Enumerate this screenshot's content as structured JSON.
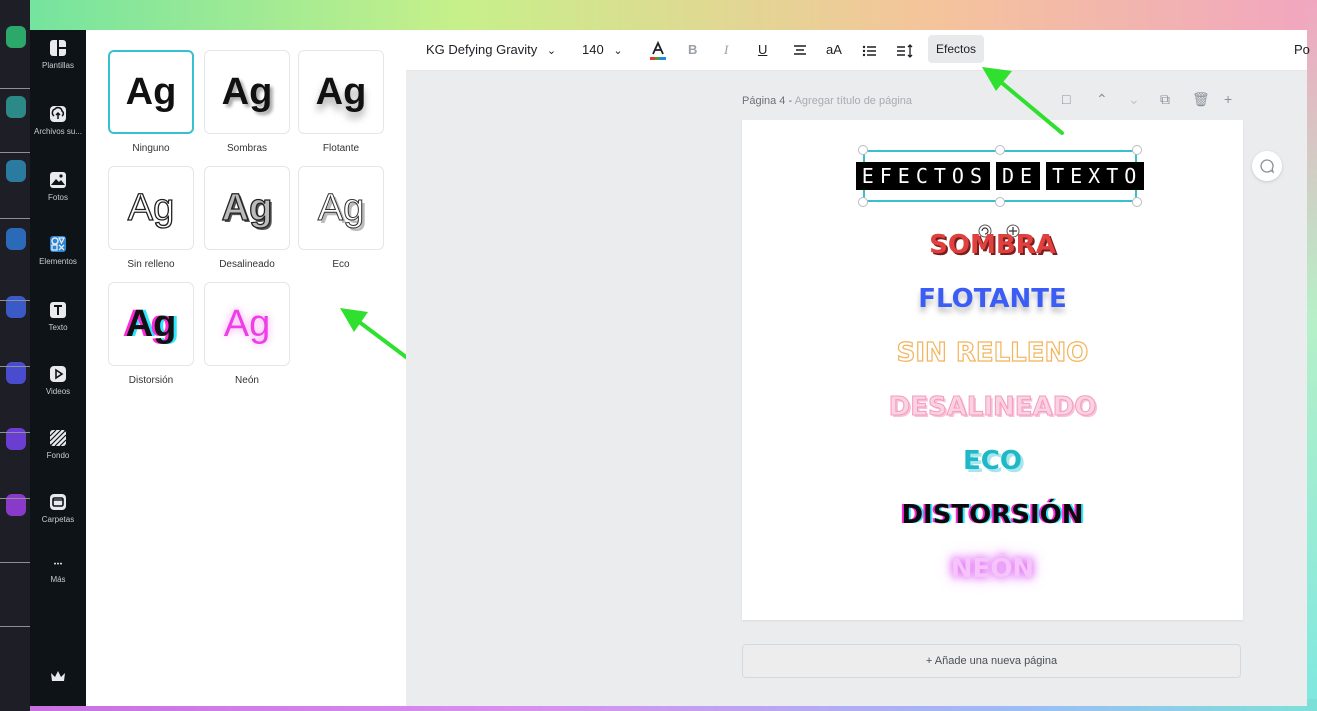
{
  "rail": {
    "items": [
      {
        "label": "Plantillas",
        "icon": "templates-icon"
      },
      {
        "label": "Archivos su...",
        "icon": "upload-icon"
      },
      {
        "label": "Fotos",
        "icon": "photos-icon"
      },
      {
        "label": "Elementos",
        "icon": "elements-icon"
      },
      {
        "label": "Texto",
        "icon": "text-icon"
      },
      {
        "label": "Videos",
        "icon": "video-icon"
      },
      {
        "label": "Fondo",
        "icon": "background-icon"
      },
      {
        "label": "Carpetas",
        "icon": "folder-icon"
      },
      {
        "label": "Más",
        "icon": "more-icon"
      }
    ],
    "premium_icon": "crown-icon"
  },
  "effects": {
    "sample": "Ag",
    "items": [
      {
        "label": "Ninguno"
      },
      {
        "label": "Sombras"
      },
      {
        "label": "Flotante"
      },
      {
        "label": "Sin relleno"
      },
      {
        "label": "Desalineado"
      },
      {
        "label": "Eco"
      },
      {
        "label": "Distorsión"
      },
      {
        "label": "Neón"
      }
    ]
  },
  "toolbar": {
    "font": "KG Defying Gravity",
    "size": "140",
    "bold": "B",
    "italic": "I",
    "underline": "U",
    "case": "aA",
    "effects": "Efectos",
    "position": "Po"
  },
  "editor": {
    "page_label": "Página 4 - ",
    "page_title_placeholder": "Agregar título de página",
    "title_words": [
      "EFECTOS",
      "DE",
      "TEXTO"
    ],
    "effect_lines": [
      "SOMBRA",
      "FLOTANTE",
      "SIN RELLENO",
      "DESALINEADO",
      "ECO",
      "DISTORSIÓN",
      "NEÓN"
    ],
    "add_page": "+ Añade una nueva página"
  },
  "colors": {
    "accent": "#39c0d0",
    "arrow": "#2fe02f",
    "sombra": "#e0413f",
    "flotante": "#3b5df5",
    "sin_relleno": "#f2b45a",
    "desalineado": "#f9a8c8",
    "eco": "#1fb8c6",
    "distorsion": "#0a0a0a",
    "neon": "#e070f5"
  }
}
